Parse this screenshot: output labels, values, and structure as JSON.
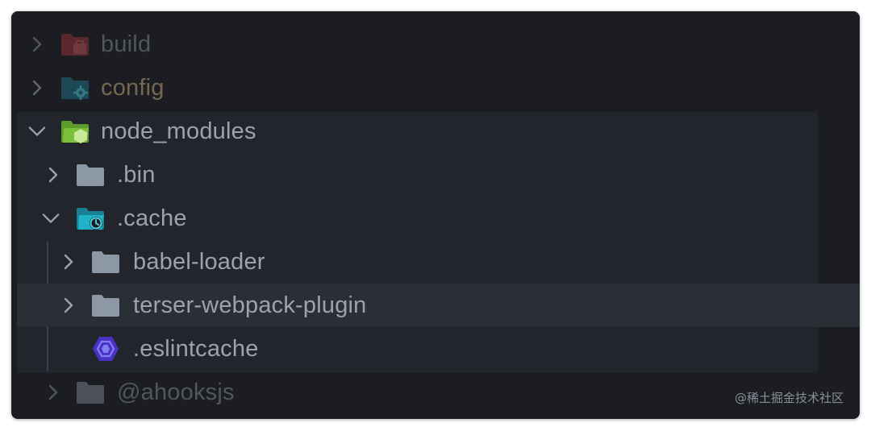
{
  "tree": {
    "items": [
      {
        "label": "build",
        "icon": "folder-build-icon",
        "state": "collapsed"
      },
      {
        "label": "config",
        "icon": "folder-config-icon",
        "state": "collapsed"
      },
      {
        "label": "node_modules",
        "icon": "folder-node-icon",
        "state": "expanded"
      },
      {
        "label": ".bin",
        "icon": "folder-icon",
        "state": "collapsed"
      },
      {
        "label": ".cache",
        "icon": "folder-cache-icon",
        "state": "expanded"
      },
      {
        "label": "babel-loader",
        "icon": "folder-icon",
        "state": "collapsed"
      },
      {
        "label": "terser-webpack-plugin",
        "icon": "folder-icon",
        "state": "collapsed"
      },
      {
        "label": ".eslintcache",
        "icon": "eslint-file-icon",
        "state": "file"
      },
      {
        "label": "@ahooksjs",
        "icon": "folder-icon",
        "state": "collapsed"
      }
    ]
  },
  "watermark": "@稀土掘金技术社区",
  "colors": {
    "background": "#1b1d22",
    "label": "#9ca3ad",
    "config_label": "#c2a575",
    "build_folder": "#b0353c",
    "config_folder": "#1f6e83",
    "node_folder": "#7bbf3a",
    "plain_folder": "#8d98a6",
    "cache_folder": "#1fb3c9",
    "eslint_icon": "#4b32c3"
  }
}
